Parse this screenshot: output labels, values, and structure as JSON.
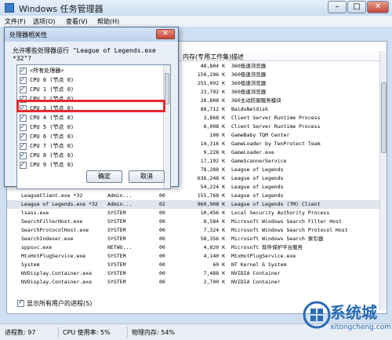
{
  "window": {
    "title": "Windows 任务管理器",
    "controls": [
      "–",
      "□",
      "✕"
    ]
  },
  "menu": [
    "文件(F)",
    "选项(O)",
    "查看(V)",
    "帮助(H)"
  ],
  "columns": {
    "mem": "内存(专用工作集)",
    "desc": "描述"
  },
  "rows": [
    {
      "mem": "48,804 K",
      "desc": "360极速浏览器"
    },
    {
      "mem": "156,296 K",
      "desc": "360极速浏览器"
    },
    {
      "mem": "255,092 K",
      "desc": "360极速浏览器"
    },
    {
      "mem": "23,792 K",
      "desc": "360极速浏览器"
    },
    {
      "mem": "28,808 K",
      "desc": "360主动防御服务模块"
    },
    {
      "mem": "88,712 K",
      "desc": "BaiduNetdisk"
    },
    {
      "mem": "3,868 K",
      "desc": "Client Server Runtime Process"
    },
    {
      "mem": "6,008 K",
      "desc": "Client Server Runtime Process"
    },
    {
      "mem": "108 K",
      "desc": "GameBaby TQM Center"
    },
    {
      "mem": "14,316 K",
      "desc": "GameLoader by TenProtect Team"
    },
    {
      "mem": "9,228 K",
      "desc": "GameLoader.exe"
    },
    {
      "mem": "17,192 K",
      "desc": "GameScannerService"
    },
    {
      "mem": "78,288 K",
      "desc": "League of Legends"
    },
    {
      "mem": "636,248 K",
      "desc": "League of Legends"
    },
    {
      "mem": "54,224 K",
      "desc": "League of Legends"
    },
    {
      "name": "LeagueClient.exe *32",
      "user": "Admin...",
      "cpu": "00",
      "mem": "155,768 K",
      "desc": "League of Legends"
    },
    {
      "name": "League of Legends.exe *32",
      "user": "Admin...",
      "cpu": "02",
      "mem": "960,908 K",
      "desc": "League of Legends (TM) Client"
    },
    {
      "name": "lsass.exe",
      "user": "SYSTEM",
      "cpu": "00",
      "mem": "10,456 K",
      "desc": "Local Security Authority Process"
    },
    {
      "name": "SearchFilterHost.exe",
      "user": "SYSTEM",
      "cpu": "00",
      "mem": "8,584 K",
      "desc": "Microsoft Windows Search Filter Host"
    },
    {
      "name": "SearchProtocolHost.exe",
      "user": "SYSTEM",
      "cpu": "00",
      "mem": "7,324 K",
      "desc": "Microsoft Windows Search Protocol Host"
    },
    {
      "name": "SearchIndexer.exe",
      "user": "SYSTEM",
      "cpu": "00",
      "mem": "58,356 K",
      "desc": "Microsoft Windows Search 索引器"
    },
    {
      "name": "sppsvc.exe",
      "user": "NETWO...",
      "cpu": "00",
      "mem": "4,820 K",
      "desc": "Microsoft 软件保护平台服务"
    },
    {
      "name": "MtxHotPlugService.exe",
      "user": "SYSTEM",
      "cpu": "00",
      "mem": "4,140 K",
      "desc": "MtxHotPlugService.exe"
    },
    {
      "name": "System",
      "user": "SYSTEM",
      "cpu": "00",
      "mem": "60 K",
      "desc": "NT Kernel & System"
    },
    {
      "name": "NVDisplay.Container.exe",
      "user": "SYSTEM",
      "cpu": "00",
      "mem": "7,488 K",
      "desc": "NVIDIA Container"
    },
    {
      "name": "NVDisplay.Container.exe",
      "user": "SYSTEM",
      "cpu": "00",
      "mem": "2,700 K",
      "desc": "NVIDIA Container"
    }
  ],
  "show_all": "显示所有用户的进程(S)",
  "status": {
    "processes": "进程数: 97",
    "cpu": "CPU 使用率: 5%",
    "memory": "物理内存: 54%"
  },
  "dialog": {
    "title": "处理器相关性",
    "close": "✕",
    "prompt": "允许哪些处理器运行 \"League of Legends.exe *32\"?",
    "items": [
      "<所有处理器>",
      "CPU 0 (节点 0)",
      "CPU 1 (节点 0)",
      "CPU 2 (节点 0)",
      "CPU 3 (节点 0)",
      "CPU 4 (节点 0)",
      "CPU 5 (节点 0)",
      "CPU 6 (节点 0)",
      "CPU 7 (节点 0)",
      "CPU 8 (节点 0)",
      "CPU 9 (节点 0)"
    ],
    "ok": "确定",
    "cancel": "取消"
  },
  "watermark": {
    "name": "系统城",
    "site": "xitongcheng.com"
  },
  "colors": {
    "highlight": "#e8292f",
    "accent": "#2a6bb5"
  }
}
